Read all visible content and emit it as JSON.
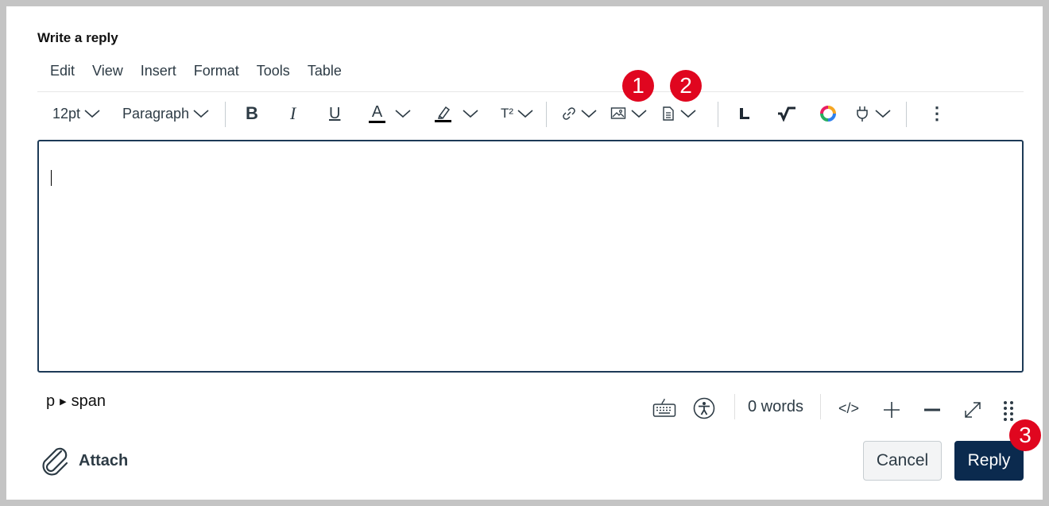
{
  "heading": "Write a reply",
  "menu": [
    "Edit",
    "View",
    "Insert",
    "Format",
    "Tools",
    "Table"
  ],
  "toolbar": {
    "font_size": "12pt",
    "block_format": "Paragraph",
    "bold_glyph": "B",
    "italic_glyph": "I",
    "underline_glyph": "U",
    "text_color_glyph": "A",
    "superscript_glyph": "T²",
    "more_glyph": "⋮"
  },
  "status": {
    "path_start": "p",
    "path_end": "span",
    "word_count": "0 words",
    "html_editor_glyph": "</>"
  },
  "attach_label": "Attach",
  "cancel_label": "Cancel",
  "reply_label": "Reply",
  "badges": [
    "1",
    "2",
    "3"
  ],
  "colors": {
    "badge": "#e0061f",
    "primary_button": "#0b2a4e",
    "editor_border": "#1d3a57",
    "text_color_bar": "#000000"
  }
}
